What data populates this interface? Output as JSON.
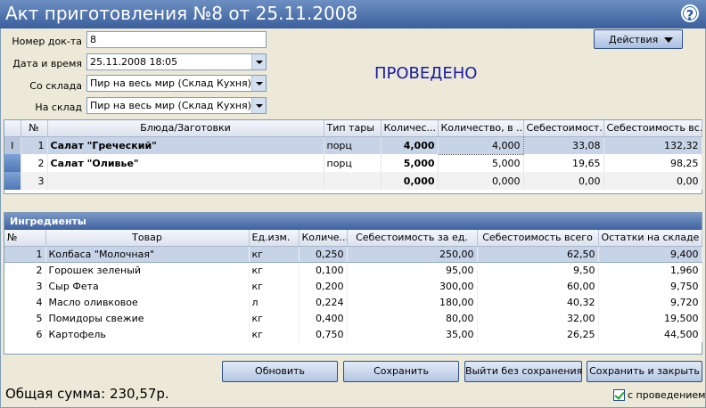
{
  "window": {
    "title": "Акт приготовления №8 от 25.11.2008"
  },
  "form": {
    "doc_num_label": "Номер док-та",
    "doc_num_value": "8",
    "datetime_label": "Дата и время",
    "datetime_value": "25.11.2008 18:05",
    "from_store_label": "Со склада",
    "from_store_value": "Пир на весь мир (Склад Кухня)",
    "to_store_label": "На склад",
    "to_store_value": "Пир на весь мир (Склад Кухня)"
  },
  "status": "ПРОВЕДЕНО",
  "actions_label": "Действия",
  "dishes": {
    "headers": [
      "№",
      "Блюда/Заготовки",
      "Тип тары",
      "Количес...",
      "Количество, в ...",
      "Себестоимост...",
      "Себестоимость вс..."
    ],
    "rows": [
      {
        "marker": "I",
        "n": "1",
        "name": "Салат \"Греческий\"",
        "tare": "порц",
        "qty": "4,000",
        "qty_base": "4,000",
        "cost": "33,08",
        "cost_total": "132,32"
      },
      {
        "marker": "",
        "n": "2",
        "name": "Салат \"Оливье\"",
        "tare": "порц",
        "qty": "5,000",
        "qty_base": "5,000",
        "cost": "19,65",
        "cost_total": "98,25"
      },
      {
        "marker": "",
        "n": "3",
        "name": "",
        "tare": "",
        "qty": "0,000",
        "qty_base": "0,000",
        "cost": "0,00",
        "cost_total": "0,00"
      }
    ]
  },
  "ingredients": {
    "title": "Ингредиенты",
    "headers": [
      "№",
      "Товар",
      "Ед.изм.",
      "Количе...",
      "Себестоимость за ед.",
      "Себестоимость всего",
      "Остатки на складе"
    ],
    "rows": [
      {
        "n": "1",
        "name": "Колбаса \"Молочная\"",
        "unit": "кг",
        "qty": "0,250",
        "unit_cost": "250,00",
        "total": "62,50",
        "stock": "9,400"
      },
      {
        "n": "2",
        "name": "Горошек зеленый",
        "unit": "кг",
        "qty": "0,100",
        "unit_cost": "95,00",
        "total": "9,50",
        "stock": "1,960"
      },
      {
        "n": "3",
        "name": "Сыр Фета",
        "unit": "кг",
        "qty": "0,200",
        "unit_cost": "300,00",
        "total": "60,00",
        "stock": "9,750"
      },
      {
        "n": "4",
        "name": "Масло оливковое",
        "unit": "л",
        "qty": "0,224",
        "unit_cost": "180,00",
        "total": "40,32",
        "stock": "9,720"
      },
      {
        "n": "5",
        "name": "Помидоры свежие",
        "unit": "кг",
        "qty": "0,400",
        "unit_cost": "80,00",
        "total": "32,00",
        "stock": "19,500"
      },
      {
        "n": "6",
        "name": "Картофель",
        "unit": "кг",
        "qty": "0,750",
        "unit_cost": "35,00",
        "total": "26,25",
        "stock": "44,500"
      }
    ]
  },
  "buttons": {
    "refresh": "Обновить",
    "save": "Сохранить",
    "exit_no_save": "Выйти без сохранения",
    "save_close": "Сохранить и закрыть"
  },
  "total_label": "Общая сумма: 230,57р.",
  "with_posting_label": "с проведением",
  "icons": {
    "help": "help-icon",
    "dropdown": "chevron-down-icon",
    "checkbox": "checkbox-checked-icon"
  }
}
